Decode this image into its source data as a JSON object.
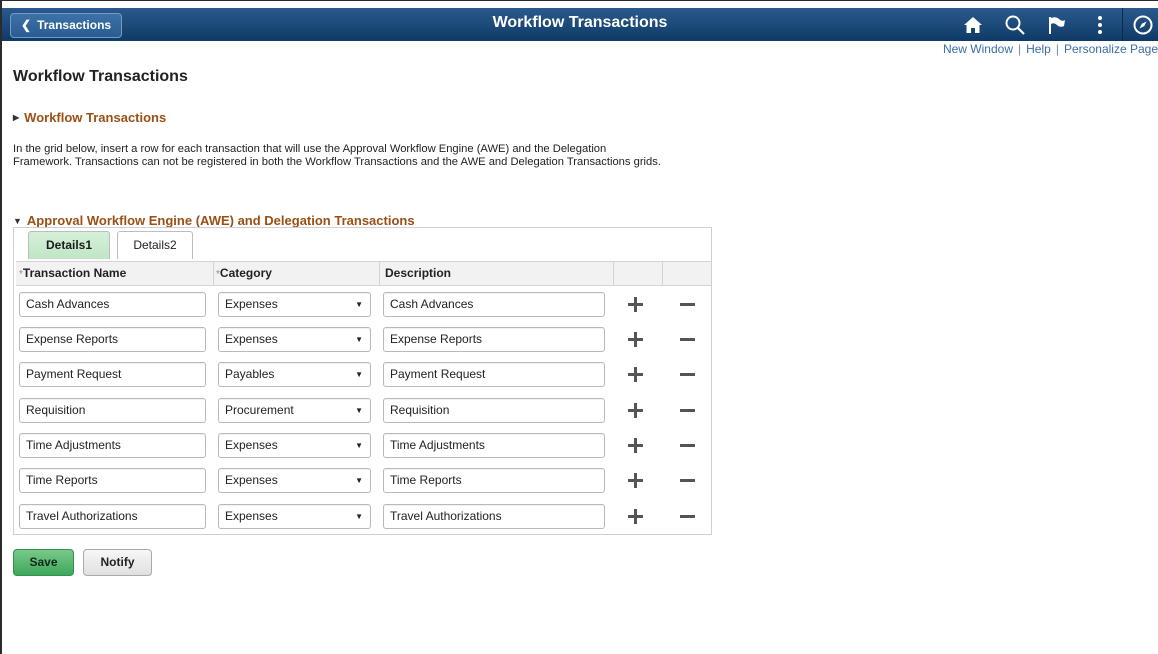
{
  "header": {
    "back_label": "Transactions",
    "title": "Workflow Transactions",
    "icons": [
      "home-icon",
      "search-icon",
      "flag-icon",
      "more-vertical-icon",
      "navigator-compass-icon"
    ]
  },
  "top_links": {
    "new_window": "New Window",
    "help": "Help",
    "personalize": "Personalize Page",
    "separator": "|"
  },
  "page": {
    "title": "Workflow Transactions",
    "collapsed_section": "Workflow Transactions",
    "instructions": "In the grid below, insert a row for each transaction that will use the Approval Workflow Engine (AWE) and the Delegation Framework. Transactions can not be registered in both the Workflow Transactions and the AWE and Delegation Transactions grids.",
    "awe_section": "Approval Workflow Engine (AWE) and Delegation Transactions"
  },
  "tabs": [
    {
      "label": "Details1",
      "active": true
    },
    {
      "label": "Details2",
      "active": false
    }
  ],
  "grid": {
    "columns": {
      "transaction_name": "Transaction Name",
      "category": "Category",
      "description": "Description",
      "required_marker": "*"
    },
    "rows": [
      {
        "name": "Cash Advances",
        "category": "Expenses",
        "description": "Cash Advances"
      },
      {
        "name": "Expense Reports",
        "category": "Expenses",
        "description": "Expense Reports"
      },
      {
        "name": "Payment Request",
        "category": "Payables",
        "description": "Payment Request"
      },
      {
        "name": "Requisition",
        "category": "Procurement",
        "description": "Requisition"
      },
      {
        "name": "Time Adjustments",
        "category": "Expenses",
        "description": "Time Adjustments"
      },
      {
        "name": "Time Reports",
        "category": "Expenses",
        "description": "Time Reports"
      },
      {
        "name": "Travel Authorizations",
        "category": "Expenses",
        "description": "Travel Authorizations"
      }
    ]
  },
  "buttons": {
    "save": "Save",
    "notify": "Notify"
  },
  "colors": {
    "banner": "#1d4a78",
    "section_title": "#9b4f14",
    "link": "#3a6ea5",
    "save_button": "#4fb168",
    "active_tab": "#c8eacc"
  }
}
